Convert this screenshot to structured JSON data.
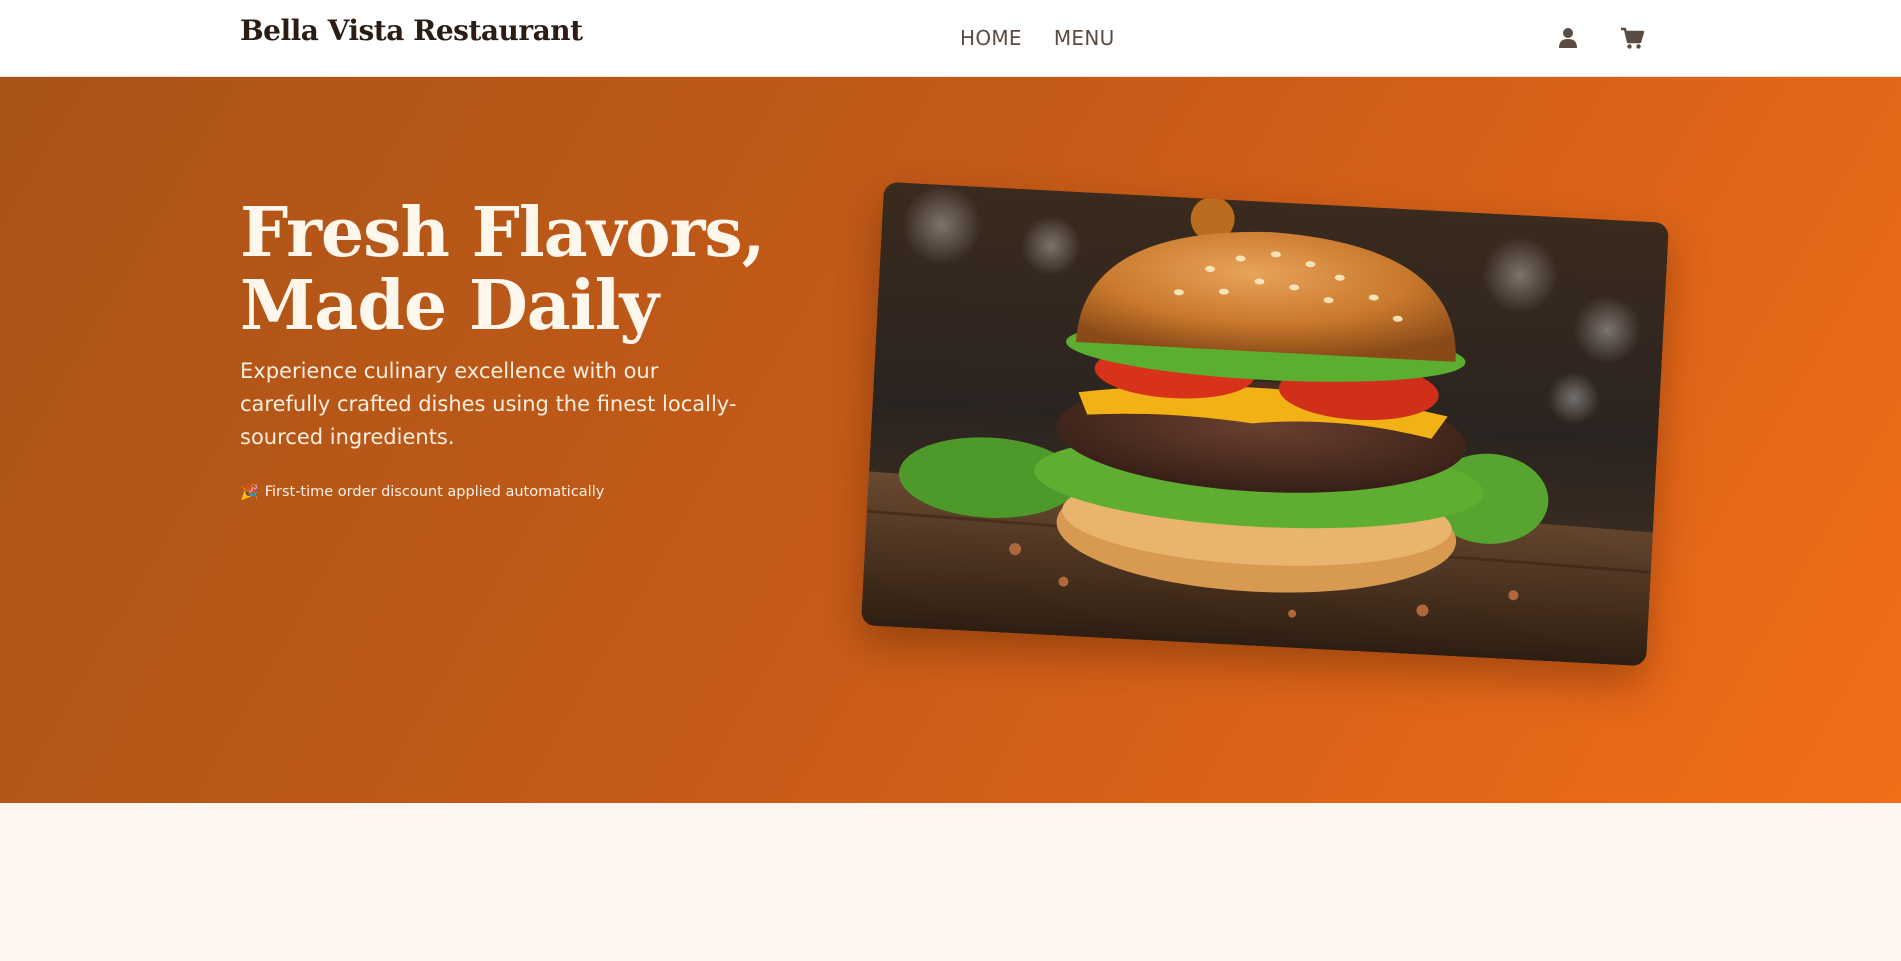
{
  "header": {
    "brand": "Bella Vista Restaurant",
    "nav": [
      {
        "label": "HOME"
      },
      {
        "label": "MENU"
      }
    ],
    "icons": [
      "user-icon",
      "cart-icon"
    ]
  },
  "hero": {
    "title_line1": "Fresh Flavors,",
    "title_line2": "Made Daily",
    "subtitle": "Experience culinary excellence with our carefully crafted dishes using the finest locally-sourced ingredients.",
    "note_icon": "🎉",
    "note": "First-time order discount applied automatically",
    "image_subject": "burger-photo"
  },
  "colors": {
    "hero_gradient_start": "#a85418",
    "hero_gradient_end": "#f26d18",
    "brand_text": "#2b1d14",
    "page_background": "#fff6f0"
  }
}
